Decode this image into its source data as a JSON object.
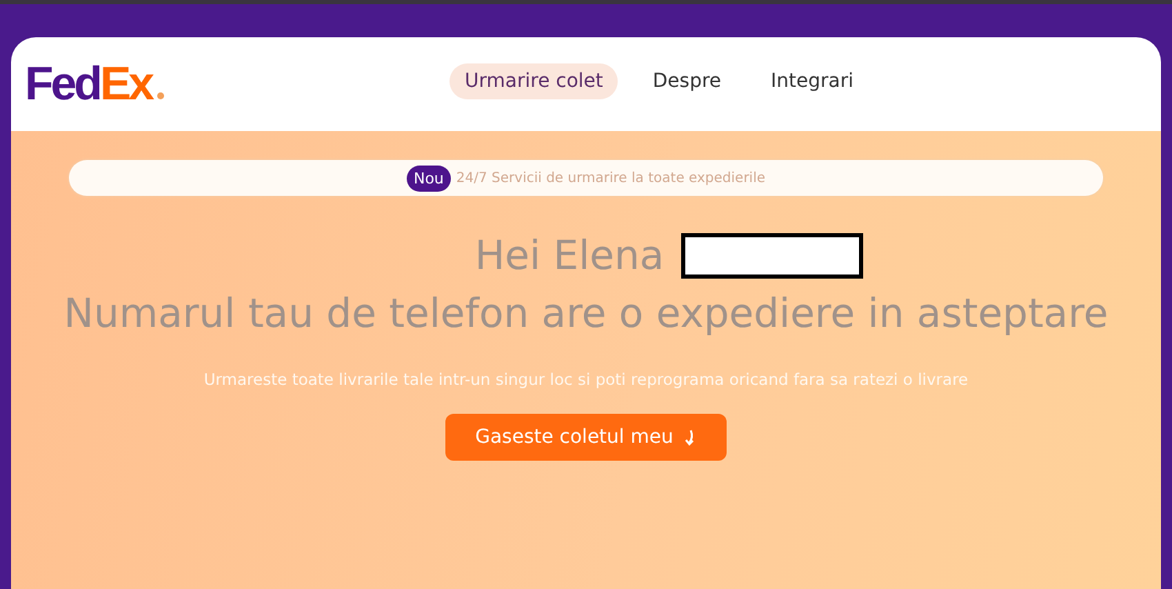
{
  "logo": {
    "part_1": "Fed",
    "part_2": "Ex"
  },
  "nav": [
    {
      "label": "Urmarire colet",
      "selected": true
    },
    {
      "label": "Despre",
      "selected": false
    },
    {
      "label": "Integrari",
      "selected": false
    }
  ],
  "banner": {
    "badge": "Nou",
    "text": "24/7 Servicii de urmarire la toate expedierile"
  },
  "greeting": "Hei Elena",
  "headline": "Numarul tau de telefon are o expediere in asteptare",
  "subtitle": "Urmareste toate livrarile tale intr-un singur loc si poti reprograma oricand fara sa ratezi o livrare",
  "cta": {
    "label": "Gaseste coletul meu"
  }
}
